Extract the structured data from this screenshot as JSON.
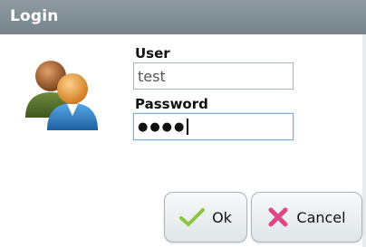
{
  "dialog": {
    "title": "Login"
  },
  "form": {
    "user_label": "User",
    "user_value": "test",
    "password_label": "Password",
    "password_mask": "●●●●"
  },
  "buttons": {
    "ok_label": "Ok",
    "cancel_label": "Cancel"
  },
  "colors": {
    "titlebar": "#7f8b91",
    "ok_check": "#8cc63f",
    "cancel_x": "#e0458a"
  },
  "icons": {
    "avatar": "users-icon",
    "ok": "check-icon",
    "cancel": "cross-icon"
  }
}
